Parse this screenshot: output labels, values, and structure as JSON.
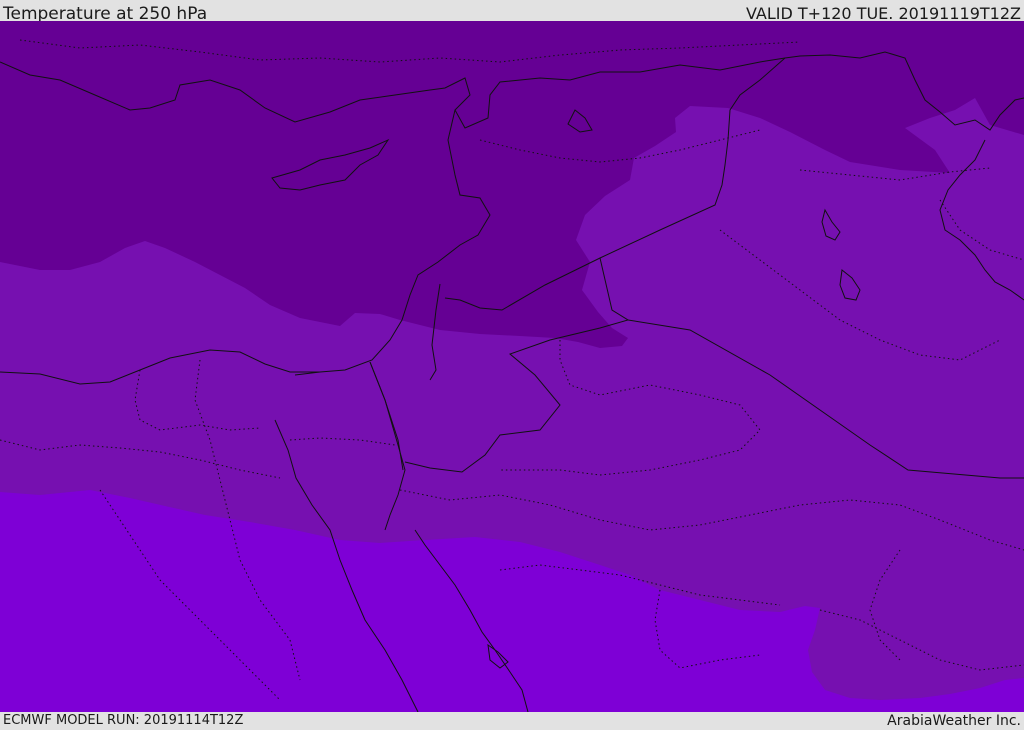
{
  "header": {
    "title": "Temperature at 250 hPa",
    "valid_time": "VALID T+120 TUE. 20191119T12Z"
  },
  "footer": {
    "model_run": "ECMWF MODEL RUN: 20191114T12Z",
    "credit": "ArabiaWeather Inc."
  },
  "map": {
    "colors": {
      "band_cold": "#650094",
      "band_mid": "#7610b0",
      "band_warm": "#7e00d6",
      "coastline": "#111111",
      "border": "#111111"
    }
  }
}
